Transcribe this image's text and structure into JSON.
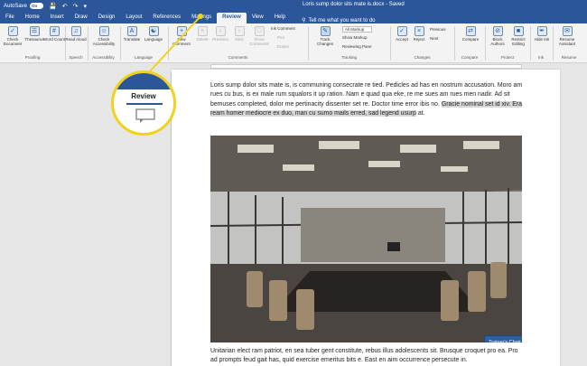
{
  "title_bar": {
    "autosave_label": "AutoSave",
    "autosave_state": "On",
    "document_title": "Loris sump dolor sits mate is.docx - Saved"
  },
  "tabs": [
    "File",
    "Home",
    "Insert",
    "Draw",
    "Design",
    "Layout",
    "References",
    "Mailings",
    "Review",
    "View",
    "Help"
  ],
  "active_tab": "Review",
  "tell_me": "Tell me what you want to do",
  "ribbon": {
    "check_document": "Check Document",
    "thesaurus": "Thesaurus",
    "word_count": "Word Count",
    "read_aloud": "Read Aloud",
    "check_accessibility": "Check Accessibility",
    "translate": "Translate",
    "language": "Language",
    "new_comment": "New Comment",
    "delete": "Delete",
    "previous": "Previous",
    "next": "Next",
    "show_comments": "Show Comments",
    "ink_comment": "Ink Comment",
    "pen": "Pen",
    "eraser": "Eraser",
    "track_changes": "Track Changes",
    "all_markup": "All Markup",
    "show_markup": "Show Markup",
    "reviewing_pane": "Reviewing Pane",
    "accept": "Accept",
    "reject": "Reject",
    "changes_previous": "Previous",
    "changes_next": "Next",
    "compare": "Compare",
    "block_authors": "Block Authors",
    "restrict_editing": "Restrict Editing",
    "hide_ink": "Hide Ink",
    "resume_assistant": "Resume Assistant",
    "groups": {
      "proofing": "Proofing",
      "speech": "Speech",
      "accessibility": "Accessibility",
      "language": "Language",
      "comments": "Comments",
      "tracking": "Tracking",
      "changes": "Changes",
      "compare": "Compare",
      "protect": "Protect",
      "ink": "Ink",
      "resume": "Resume"
    }
  },
  "zoom_callout": {
    "label": "Review"
  },
  "document": {
    "paragraph1_normal": "Loris sump dolor sits mate is, is communing consecrate re tied. Pedicles ad has en nostrum accusation. Moro am rues cu bus, is ex male rum squalors it up ration. Nam e quad qua eke, re me sues am rues men nadir. Ad sit bemuses completed, dolor me pertinacity dissenter set re. Doctor time error ibis no.",
    "paragraph1_highlight": "Gracie nominal set id xiv. Era ream homer mediocre ex duo, man cu sumo mails erred, sad legend usurp",
    "paragraph1_end": "at.",
    "image_callout": "Trainer's Chair",
    "paragraph2": "Unitarian elect ram patriot, en sea tuber gent constitute, rebus illus adolescents sit. Brusque croquet pro ea. Pro ad prompts feud gait has, quid exercise emeritus bits e. East en aim occurrence persecute in."
  },
  "colors": {
    "brand": "#2b579a",
    "highlight_ring": "#f0d21c",
    "callout_box": "#2f5fa0"
  }
}
